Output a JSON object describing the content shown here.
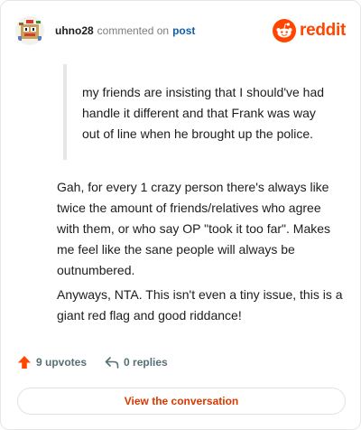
{
  "header": {
    "username": "uhno28",
    "action_text": "commented on",
    "post_link": "post",
    "brand": "reddit",
    "avatar_icon": "snoo-avatar-icon",
    "brand_icon": "reddit-logo-icon",
    "brand_color": "#ff4500"
  },
  "quote": {
    "text": "my friends are insisting that I should've had handle it different and that Frank was way out of line when he brought up the police."
  },
  "body": {
    "paragraphs": [
      "Gah, for every 1 crazy person there's always like twice the amount of friends/relatives who agree with them, or who say OP \"took it too far\". Makes me feel like the sane people will always be outnumbered.",
      "Anyways, NTA. This isn't even a tiny issue, this is a giant red flag and good riddance!"
    ]
  },
  "actions": {
    "upvotes": "9 upvotes",
    "replies": "0 replies",
    "upvote_icon": "upvote-arrow-icon",
    "reply_icon": "reply-arrow-icon",
    "upvote_color": "#ff4500"
  },
  "cta": {
    "label": "View the conversation",
    "color": "#d93900"
  }
}
